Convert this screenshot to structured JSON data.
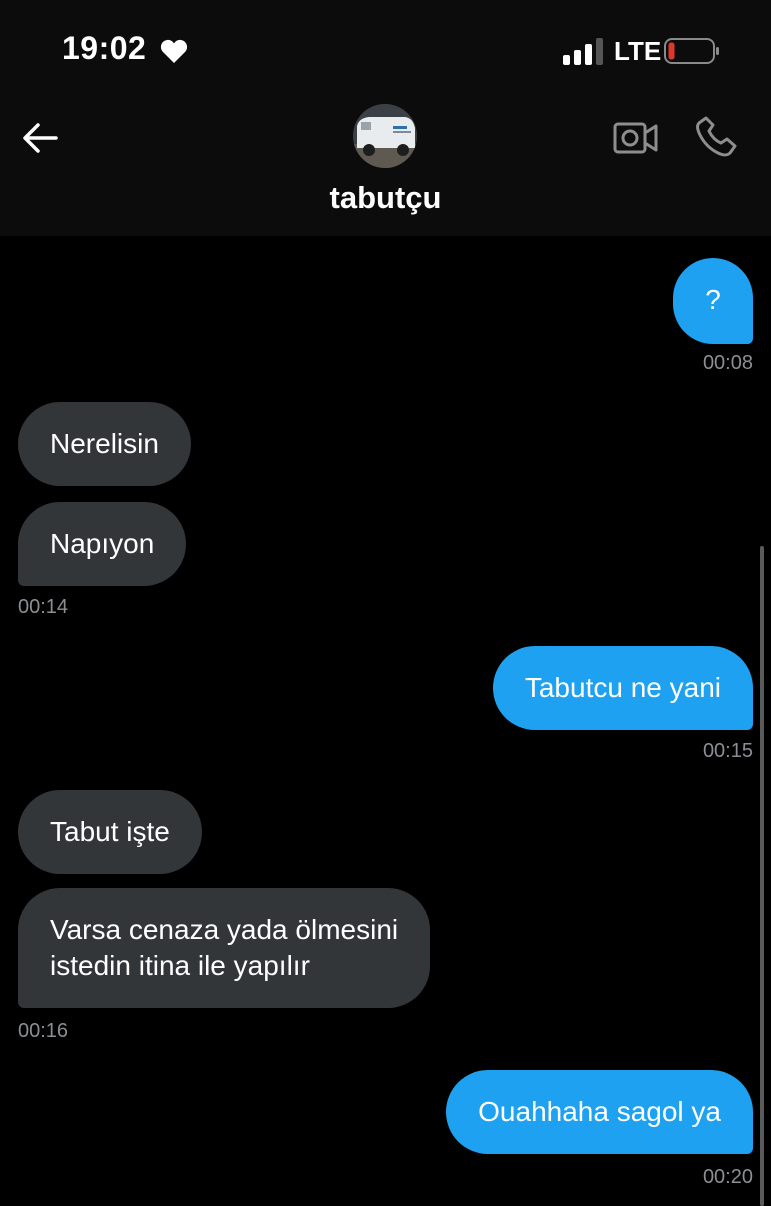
{
  "status_bar": {
    "time": "19:02",
    "network": "LTE",
    "icons": [
      "heart-icon",
      "signal-icon",
      "battery-low-icon"
    ],
    "battery_color": "#e0362c"
  },
  "header": {
    "title": "tabutçu",
    "icons": [
      "back-arrow-icon",
      "video-call-icon",
      "phone-call-icon"
    ]
  },
  "colors": {
    "incoming_bubble": "#333639",
    "outgoing_bubble": "#1ea1f1",
    "timestamp": "#8b8f94"
  },
  "messages": [
    {
      "direction": "out",
      "text": "?",
      "time": "00:08"
    },
    {
      "direction": "in",
      "text": "Nerelisin"
    },
    {
      "direction": "in",
      "text": "Napıyon",
      "time": "00:14"
    },
    {
      "direction": "out",
      "text": "Tabutcu ne yani",
      "time": "00:15"
    },
    {
      "direction": "in",
      "text": "Tabut işte"
    },
    {
      "direction": "in",
      "text": "Varsa cenaza yada ölmesini\nistedin itina ile yapılır",
      "time": "00:16"
    },
    {
      "direction": "out",
      "text": "Ouahhaha sagol ya",
      "time": "00:20"
    }
  ]
}
